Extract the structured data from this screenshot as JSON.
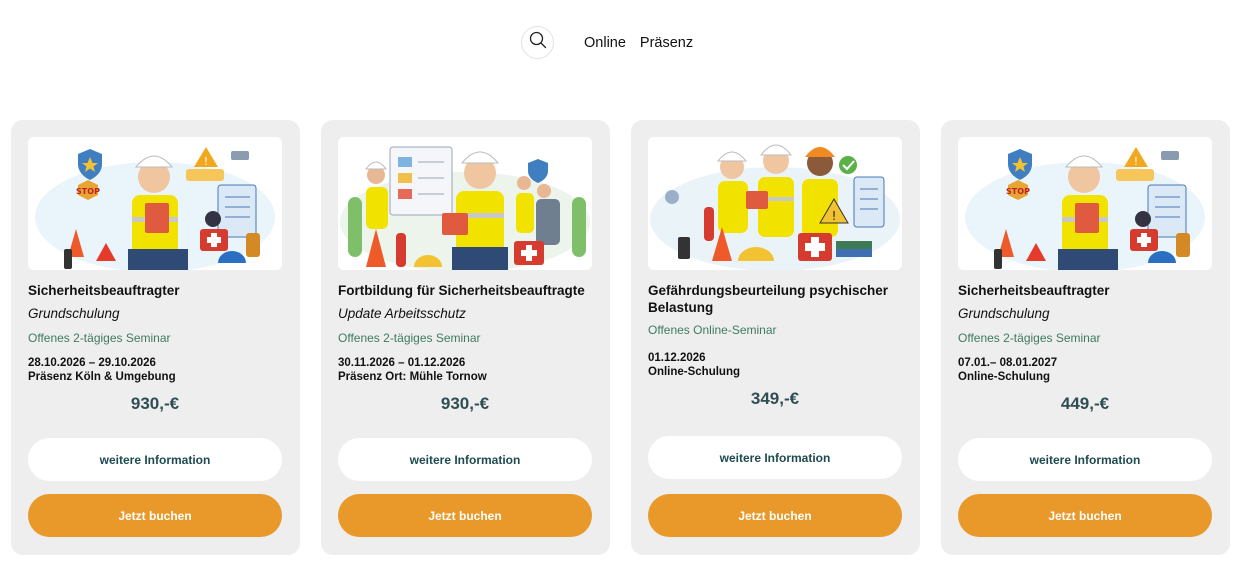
{
  "nav": {
    "search_icon": "search-icon",
    "links": [
      "Online",
      "Präsenz"
    ]
  },
  "colors": {
    "card_bg": "#eeeeee",
    "accent_orange": "#e8992a",
    "type_green": "#3f7a60",
    "price_color": "#2f4e54"
  },
  "cards": [
    {
      "image": "safety-officer-illustration",
      "title": "Sicherheitsbeauftragter",
      "subtitle": "Grundschulung",
      "type": "Offenes 2-tägiges Seminar",
      "dates": "28.10.2026 – 29.10.2026",
      "location": "Präsenz Köln & Umgebung",
      "price": "930,-€",
      "info_label": "weitere Information",
      "book_label": "Jetzt buchen"
    },
    {
      "image": "training-update-illustration",
      "title": "Fortbildung für Sicherheitsbeauftragte",
      "subtitle": "Update Arbeitsschutz",
      "type": "Offenes 2-tägiges Seminar",
      "dates": "30.11.2026 – 01.12.2026",
      "location": "Präsenz Ort: Mühle Tornow",
      "price": "930,-€",
      "info_label": "weitere Information",
      "book_label": "Jetzt buchen"
    },
    {
      "image": "risk-assessment-team-illustration",
      "title": "Gefährdungsbeurteilung psychischer Belastung",
      "subtitle": "",
      "type": "Offenes Online-Seminar",
      "dates": "01.12.2026",
      "location": "Online-Schulung",
      "price": "349,-€",
      "info_label": "weitere Information",
      "book_label": "Jetzt buchen"
    },
    {
      "image": "safety-officer-illustration",
      "title": "Sicherheitsbeauftragter",
      "subtitle": "Grundschulung",
      "type": "Offenes 2-tägiges Seminar",
      "dates": "07.01.– 08.01.2027",
      "location": "Online-Schulung",
      "price": "449,-€",
      "info_label": "weitere Information",
      "book_label": "Jetzt buchen"
    }
  ]
}
